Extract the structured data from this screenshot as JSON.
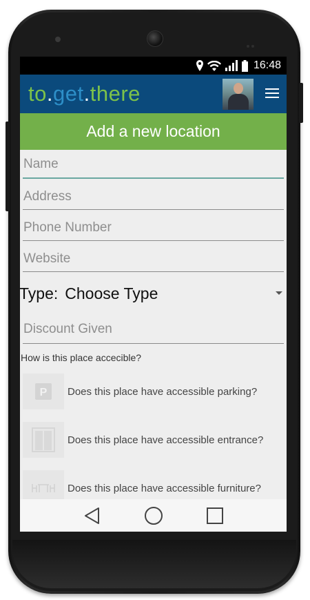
{
  "status_bar": {
    "time": "16:48",
    "icons": [
      "location-icon",
      "wifi-icon",
      "signal-icon",
      "battery-icon"
    ]
  },
  "app_bar": {
    "logo": {
      "part1": "to",
      "sep1": ".",
      "part2": "get",
      "sep2": ".",
      "part3": "there"
    },
    "menu_icon": "menu-icon",
    "colors": {
      "background": "#0b4a7c",
      "logo_green": "#7cc24a",
      "logo_blue": "#2d8fc8"
    }
  },
  "header": {
    "title": "Add a new location",
    "color": "#73b04a"
  },
  "form": {
    "name_placeholder": "Name",
    "address_placeholder": "Address",
    "phone_placeholder": "Phone Number",
    "website_placeholder": "Website",
    "type_label": "Type:",
    "type_value": "Choose Type",
    "discount_placeholder": "Discount Given"
  },
  "accessibility": {
    "title": "How is this place accecible?",
    "items": [
      {
        "icon": "parking-icon",
        "label": "Does this place have accessible parking?"
      },
      {
        "icon": "entrance-icon",
        "label": "Does this place have accessible entrance?"
      },
      {
        "icon": "furniture-icon",
        "label": "Does this place have accessible furniture?"
      }
    ]
  },
  "nav_bar": {
    "buttons": [
      "back-icon",
      "home-icon",
      "recents-icon"
    ]
  }
}
